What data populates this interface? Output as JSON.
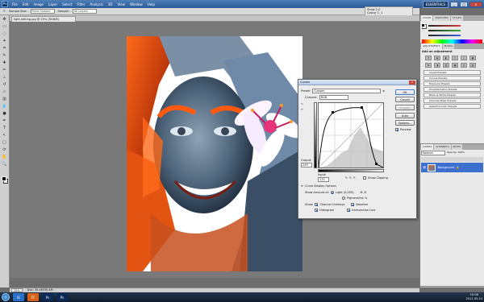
{
  "menubar": {
    "logo": "Ps",
    "items": [
      "File",
      "Edit",
      "Image",
      "Layer",
      "Select",
      "Filter",
      "Analysis",
      "3D",
      "View",
      "Window",
      "Help"
    ],
    "workspace": "ESSENTIALS",
    "win_min": "_",
    "win_max": "□",
    "win_close": "✕"
  },
  "options": {
    "sample_size_label": "Sample Size:",
    "sample_size_value": "Point Sample",
    "sample_label": "Sample:",
    "sample_value": "All Layers"
  },
  "navigator": {
    "title": "Show 2.0",
    "line1": "Colour 1: 1",
    "line2": "Help  Settings"
  },
  "document": {
    "tab_title": "light-editing.jpg @ 25% (RGB/8)"
  },
  "curves": {
    "title": "Curves",
    "preset_label": "Preset:",
    "preset_value": "Custom",
    "channel_label": "Channel:",
    "channel_value": "RGB",
    "ok": "OK",
    "cancel": "Cancel",
    "smooth": "Smooth",
    "auto": "Auto",
    "options": "Options...",
    "preview": "Preview",
    "output_label": "Output:",
    "output_value": "249",
    "input_label": "Input:",
    "input_value": "172",
    "show_clipping": "Show Clipping",
    "display_options": "Curve Display Options",
    "show_amount_label": "Show Amount of:",
    "light_option": "Light (0-255)",
    "pigment_option": "Pigment/Ink %",
    "show_label": "Show:",
    "channel_overlays": "Channel Overlays",
    "baseline": "Baseline",
    "histogram": "Histogram",
    "intersection_line": "Intersection Line"
  },
  "color_panel": {
    "tabs": [
      "COLOR",
      "SWATCHES",
      "STYLES"
    ],
    "slider_colors": [
      "#e03c3c",
      "#3cae3c",
      "#3c64e0"
    ]
  },
  "adjustments": {
    "tabs": [
      "ADJUSTMENTS",
      "MASKS"
    ],
    "title": "Add an adjustment",
    "icons": [
      "☀",
      "▤",
      "◐",
      "▽",
      "◇",
      "▣",
      "⚖",
      "◑",
      "▥",
      "▦",
      "◎",
      "▧"
    ],
    "presets": [
      "Levels Presets",
      "Curves Presets",
      "Exposure Presets",
      "Hue/Saturation Presets",
      "Black & White Presets",
      "Channel Mixer Presets",
      "Selective Color Presets"
    ]
  },
  "layers": {
    "tabs": [
      "LAYERS",
      "CHANNELS",
      "PATHS"
    ],
    "blend_mode": "Normal",
    "opacity": "Opacity: 100%",
    "layer_name": "Background"
  },
  "status": {
    "zoom": "25%",
    "doc": "Doc: 35.4M/35.4M"
  },
  "taskbar": {
    "apps": [
      "IE",
      "FF",
      "Ps",
      "Ps"
    ],
    "time": "10:08",
    "date": "2011-05-24"
  }
}
